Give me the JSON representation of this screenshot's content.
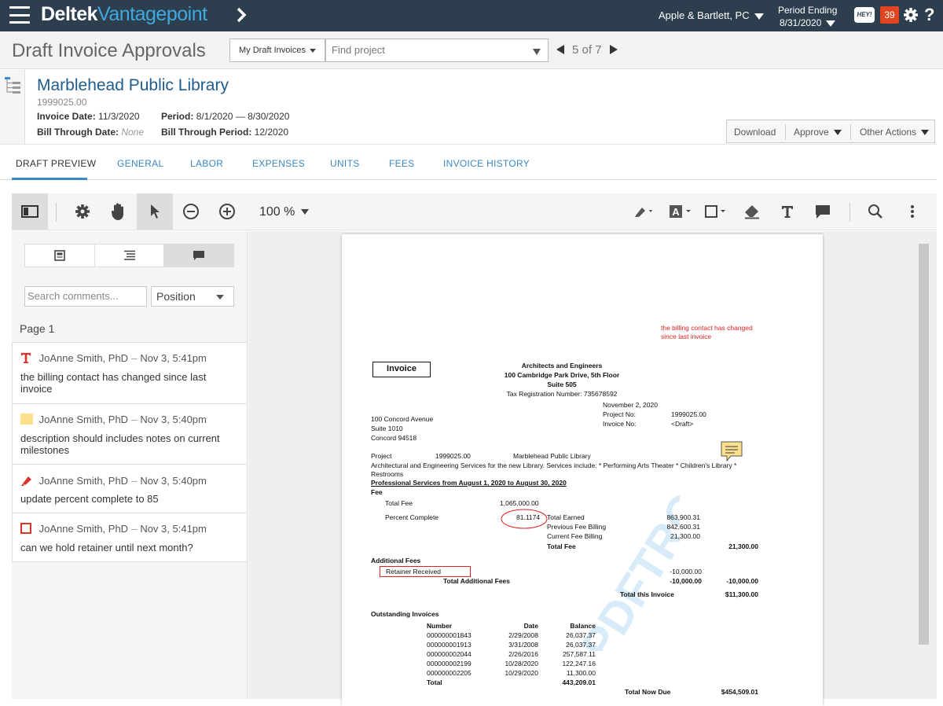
{
  "app": {
    "brand_primary": "Deltek",
    "brand_secondary": "Vantagepoint",
    "company": "Apple & Bartlett, PC",
    "period_label": "Period Ending",
    "period_date": "8/31/2020",
    "hey_label": "HEY!",
    "notification_count": "39",
    "help_label": "?"
  },
  "header": {
    "title": "Draft Invoice Approvals",
    "view_select": "My Draft Invoices",
    "find_placeholder": "Find project",
    "pager_current": "5",
    "pager_of": "of 7"
  },
  "project": {
    "name": "Marblehead Public Library",
    "number": "1999025.00",
    "invoice_date_label": "Invoice Date:",
    "invoice_date": "11/3/2020",
    "period_label": "Period:",
    "period": "8/1/2020 — 8/30/2020",
    "bill_through_date_label": "Bill Through Date:",
    "bill_through_date": "None",
    "bill_through_period_label": "Bill Through Period:",
    "bill_through_period": "12/2020",
    "actions": {
      "download": "Download",
      "approve": "Approve",
      "other": "Other Actions"
    }
  },
  "tabs": [
    "DRAFT PREVIEW",
    "GENERAL",
    "LABOR",
    "EXPENSES",
    "UNITS",
    "FEES",
    "INVOICE HISTORY"
  ],
  "viewer": {
    "zoom": "100 %"
  },
  "comments_panel": {
    "search_placeholder": "Search comments...",
    "sort": "Position",
    "page_label": "Page 1",
    "items": [
      {
        "icon": "text-icon",
        "author": "JoAnne Smith, PhD",
        "time": "Nov 3, 5:41pm",
        "text": "the billing contact has changed since last invoice"
      },
      {
        "icon": "note-icon",
        "author": "JoAnne Smith, PhD",
        "time": "Nov 3, 5:40pm",
        "text": "description should includes notes on current milestones"
      },
      {
        "icon": "highlighter-icon",
        "author": "JoAnne Smith, PhD",
        "time": "Nov 3, 5:40pm",
        "text": "update percent complete to 85"
      },
      {
        "icon": "rectangle-icon",
        "author": "JoAnne Smith, PhD",
        "time": "Nov 3, 5:41pm",
        "text": "can we hold retainer until next month?"
      }
    ]
  },
  "invoice": {
    "annotation_line1": "the billing contact has changed",
    "annotation_line2": "since last invoice",
    "title": "Invoice",
    "firm_name": "Architects and Engineers",
    "firm_address1": "100 Cambridge Park Drive, 5th Floor",
    "firm_address2": "Suite 505",
    "firm_tax": "Tax Registration Number: 735678592",
    "date": "November 2, 2020",
    "project_no_label": "Project No:",
    "project_no": "1999025.00",
    "invoice_no_label": "Invoice No:",
    "invoice_no": "<Draft>",
    "client_address1": "100 Concord Avenue",
    "client_address2": "Suite 1010",
    "client_address3": "Concord  94518",
    "project_label": "Project",
    "project_number": "1999025.00",
    "project_name": "Marblehead Public Library",
    "description1": "Architectural and Engineering Services for the new Library. Services include: * Performing Arts Theater * Children's Library *",
    "description2": "Restrooms",
    "services_heading": "Professional Services from August 1, 2020 to August 30, 2020",
    "fee_heading": "Fee",
    "total_fee_label": "Total Fee",
    "total_fee": "1,065,000.00",
    "percent_complete_label": "Percent Complete",
    "percent_complete": "81.1174",
    "total_earned_label": "Total Earned",
    "total_earned": "863,900.31",
    "previous_billing_label": "Previous Fee Billing",
    "previous_billing": "842,600.31",
    "current_billing_label": "Current Fee Billing",
    "current_billing": "21,300.00",
    "total_fee_row_label": "Total Fee",
    "total_fee_row": "21,300.00",
    "additional_fees_heading": "Additional Fees",
    "retainer_label": "Retainer Received",
    "retainer_amount": "-10,000.00",
    "total_additional_label": "Total Additional Fees",
    "total_additional": "-10,000.00",
    "total_additional_right": "-10,000.00",
    "total_invoice_label": "Total this Invoice",
    "total_invoice": "$11,300.00",
    "outstanding_heading": "Outstanding Invoices",
    "outstanding_headers": {
      "number": "Number",
      "date": "Date",
      "balance": "Balance"
    },
    "outstanding_rows": [
      {
        "number": "000000001843",
        "date": "2/29/2008",
        "balance": "26,037.37"
      },
      {
        "number": "000000001913",
        "date": "3/31/2008",
        "balance": "26,037.37"
      },
      {
        "number": "000000002044",
        "date": "2/26/2016",
        "balance": "257,587.11"
      },
      {
        "number": "000000002199",
        "date": "10/28/2020",
        "balance": "122,247.16"
      },
      {
        "number": "000000002205",
        "date": "10/29/2020",
        "balance": "11,300.00"
      }
    ],
    "outstanding_total_label": "Total",
    "outstanding_total": "443,209.01",
    "total_due_label": "Total Now Due",
    "total_due": "$454,509.01",
    "watermark": "PDFTRON"
  },
  "colors": {
    "topbar": "#2d3e4f",
    "brand_accent": "#3fa9e1",
    "link": "#3a88c5",
    "annotation_red": "#d22",
    "badge": "#e0451f"
  }
}
